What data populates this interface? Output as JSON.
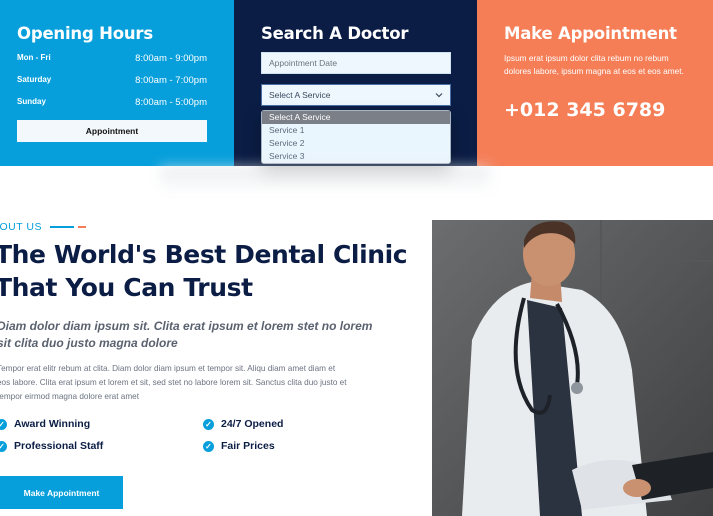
{
  "hours": {
    "title": "Opening Hours",
    "rows": [
      {
        "day": "Mon - Fri",
        "time": "8:00am - 9:00pm"
      },
      {
        "day": "Saturday",
        "time": "8:00am - 7:00pm"
      },
      {
        "day": "Sunday",
        "time": "8:00am - 5:00pm"
      }
    ],
    "button_label": "Appointment"
  },
  "search": {
    "title": "Search A Doctor",
    "date_placeholder": "Appointment Date",
    "select_value": "Select A Service",
    "options": [
      "Select A Service",
      "Service 1",
      "Service 2",
      "Service 3"
    ]
  },
  "appointment": {
    "title": "Make Appointment",
    "text": "Ipsum erat ipsum dolor clita rebum no rebum dolores labore, ipsum magna at eos et eos amet.",
    "phone": "+012 345 6789"
  },
  "about": {
    "label": "BOUT US",
    "headline_1": "The World's Best Dental Clinic",
    "headline_2": "That You Can Trust",
    "italic_1": "Diam dolor diam ipsum sit. Clita erat ipsum et lorem stet no lorem",
    "italic_2": "sit clita duo justo magna dolore",
    "para_1": "Tempor erat elitr rebum at clita. Diam dolor diam ipsum et tempor sit. Aliqu diam amet diam et",
    "para_2": "eos labore. Clita erat ipsum et lorem et sit, sed stet no labore lorem sit. Sanctus clita duo justo et",
    "para_3": "tempor eirmod magna dolore erat amet",
    "features": [
      "Award Winning",
      "24/7 Opened",
      "Professional Staff",
      "Fair Prices"
    ],
    "button_label": "Make Appointment"
  },
  "colors": {
    "primary": "#069fdb",
    "navy": "#0b1d45",
    "orange": "#f57e57"
  }
}
